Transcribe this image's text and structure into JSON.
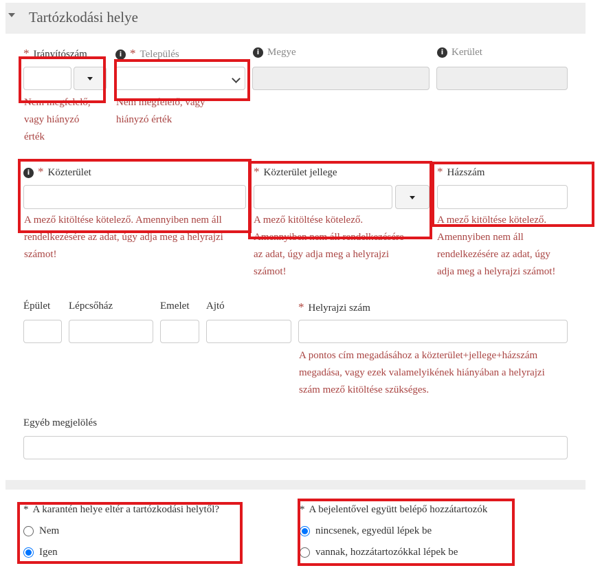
{
  "section": {
    "title": "Tartózkodási helye"
  },
  "fields": {
    "iranyitoszam": {
      "label": "Irányítószám",
      "error": [
        "Nem megfelelő,",
        "vagy hiányzó",
        "érték"
      ]
    },
    "telepules": {
      "label": "Település",
      "error": [
        "Nem megfelelő, vagy",
        "hiányzó érték"
      ]
    },
    "megye": {
      "label": "Megye"
    },
    "kerulet": {
      "label": "Kerület"
    },
    "kozterulet": {
      "label": "Közterület",
      "error": [
        "A mező kitöltése kötelező. Amennyiben nem áll",
        "rendelkezésére az adat, úgy adja meg a helyrajzi",
        "számot!"
      ]
    },
    "kozterulet_jellege": {
      "label": "Közterület jellege",
      "error": [
        "A mező kitöltése kötelező.",
        "Amennyiben nem áll rendelkezésére",
        "az adat, úgy adja meg a helyrajzi",
        "számot!"
      ]
    },
    "hazszam": {
      "label": "Házszám",
      "error": [
        "A mező kitöltése kötelező.",
        "Amennyiben nem áll",
        "rendelkezésére az adat, úgy",
        "adja meg a helyrajzi számot!"
      ]
    },
    "epulet": {
      "label": "Épület"
    },
    "lepcsohaz": {
      "label": "Lépcsőház"
    },
    "emelet": {
      "label": "Emelet"
    },
    "ajto": {
      "label": "Ajtó"
    },
    "helyrajzi_szam": {
      "label": "Helyrajzi szám",
      "error": [
        "A pontos cím megadásához a közterület+jellege+házszám",
        "megadása, vagy ezek valamelyikének hiányában a helyrajzi",
        "szám mező kitöltése szükséges."
      ]
    },
    "egyeb": {
      "label": "Egyéb megjelölés"
    }
  },
  "quarantine": {
    "question": "A karantén helye eltér a tartózkodási helytől?",
    "options": [
      {
        "label": "Nem",
        "selected": false
      },
      {
        "label": "Igen",
        "selected": true
      }
    ]
  },
  "dependents": {
    "question": "A bejelentővel együtt belépő hozzátartozók",
    "options": [
      {
        "label": "nincsenek, egyedül lépek be",
        "selected": true
      },
      {
        "label": "vannak, hozzátartozókkal lépek be",
        "selected": false
      }
    ]
  },
  "icons": {
    "info": "info-icon",
    "required": "required-asterisk",
    "dropdown": "caret-down-icon",
    "select": "chevron-down-icon",
    "section_toggle": "caret-down-icon"
  },
  "colors": {
    "error_text": "#a94442",
    "required_star": "#b0443c",
    "highlight_box": "#e0181d",
    "radio_selected": "#0075ff",
    "section_bg": "#eeeeee"
  }
}
